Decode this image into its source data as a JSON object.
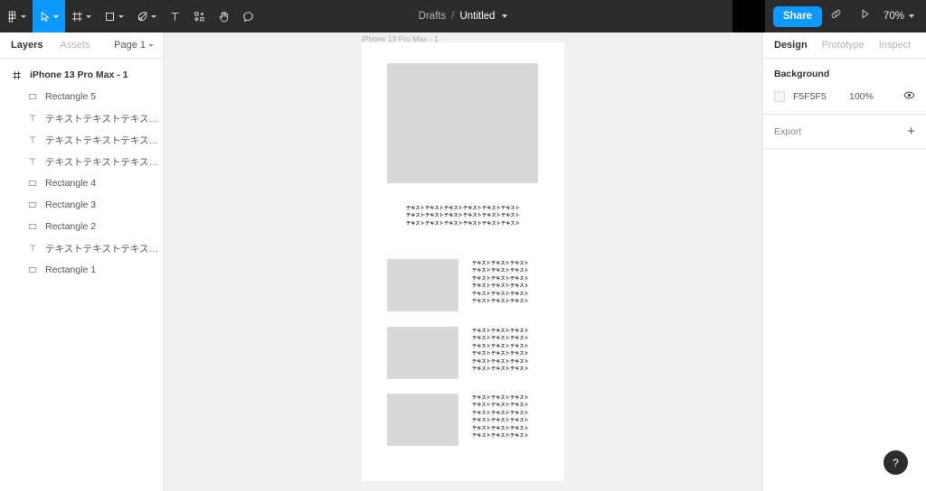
{
  "toolbar": {
    "tools": [
      {
        "name": "figma-logo-icon",
        "has_caret": true,
        "active": false
      },
      {
        "name": "move-tool-icon",
        "has_caret": true,
        "active": true
      },
      {
        "name": "frame-tool-icon",
        "has_caret": true,
        "active": false
      },
      {
        "name": "rectangle-tool-icon",
        "has_caret": true,
        "active": false
      },
      {
        "name": "pen-tool-icon",
        "has_caret": true,
        "active": false
      },
      {
        "name": "text-tool-icon",
        "has_caret": false,
        "active": false
      },
      {
        "name": "components-tool-icon",
        "has_caret": false,
        "active": false
      },
      {
        "name": "hand-tool-icon",
        "has_caret": false,
        "active": false
      },
      {
        "name": "comment-tool-icon",
        "has_caret": false,
        "active": false
      }
    ],
    "breadcrumb": {
      "project": "Drafts",
      "separator": "/",
      "file": "Untitled"
    },
    "share_label": "Share",
    "zoom_level": "70%",
    "accent_color": "#0D99FF",
    "background_color": "#2C2C2C"
  },
  "left_panel": {
    "tabs": [
      {
        "label": "Layers",
        "active": true
      },
      {
        "label": "Assets",
        "active": false
      }
    ],
    "page_selector": "Page 1",
    "layers": [
      {
        "name": "iPhone 13 Pro Max - 1",
        "icon": "frame-icon",
        "type": "frame"
      },
      {
        "name": "Rectangle 5",
        "icon": "rectangle-icon",
        "type": "shape"
      },
      {
        "name": "テキストテキストテキスト テキ...",
        "icon": "text-icon",
        "type": "text"
      },
      {
        "name": "テキストテキストテキスト テキ...",
        "icon": "text-icon",
        "type": "text"
      },
      {
        "name": "テキストテキストテキスト テキ...",
        "icon": "text-icon",
        "type": "text"
      },
      {
        "name": "Rectangle 4",
        "icon": "rectangle-icon",
        "type": "shape"
      },
      {
        "name": "Rectangle 3",
        "icon": "rectangle-icon",
        "type": "shape"
      },
      {
        "name": "Rectangle 2",
        "icon": "rectangle-icon",
        "type": "shape"
      },
      {
        "name": "テキストテキストテキストテキ...",
        "icon": "text-icon",
        "type": "text"
      },
      {
        "name": "Rectangle 1",
        "icon": "rectangle-icon",
        "type": "shape"
      }
    ]
  },
  "canvas": {
    "frame_label": "iPhone 13 Pro Max - 1",
    "background_color": "#F0F0F0",
    "artboard_color": "#FFFFFF",
    "placeholder_color": "#D9D9D9",
    "hero_caption": "テキストテキストテキストテキストテキストテキスト\nテキストテキストテキストテキストテキストテキスト\nテキストテキストテキストテキストテキストテキスト",
    "cards": [
      {
        "text": "テキストテキストテキスト\nテキストテキストテキスト\nテキストテキストテキスト\nテキストテキストテキスト\nテキストテキストテキスト\nテキストテキストテキスト"
      },
      {
        "text": "テキストテキストテキスト\nテキストテキストテキスト\nテキストテキストテキスト\nテキストテキストテキスト\nテキストテキストテキスト\nテキストテキストテキスト"
      },
      {
        "text": "テキストテキストテキスト\nテキストテキストテキスト\nテキストテキストテキスト\nテキストテキストテキスト\nテキストテキストテキスト\nテキストテキストテキスト"
      }
    ],
    "help_label": "?"
  },
  "right_panel": {
    "tabs": [
      {
        "label": "Design",
        "active": true
      },
      {
        "label": "Prototype",
        "active": false
      },
      {
        "label": "Inspect",
        "active": false
      }
    ],
    "background": {
      "title": "Background",
      "hex": "F5F5F5",
      "opacity": "100%",
      "swatch_color": "#F5F5F5"
    },
    "export": {
      "label": "Export",
      "add_label": "+"
    }
  }
}
